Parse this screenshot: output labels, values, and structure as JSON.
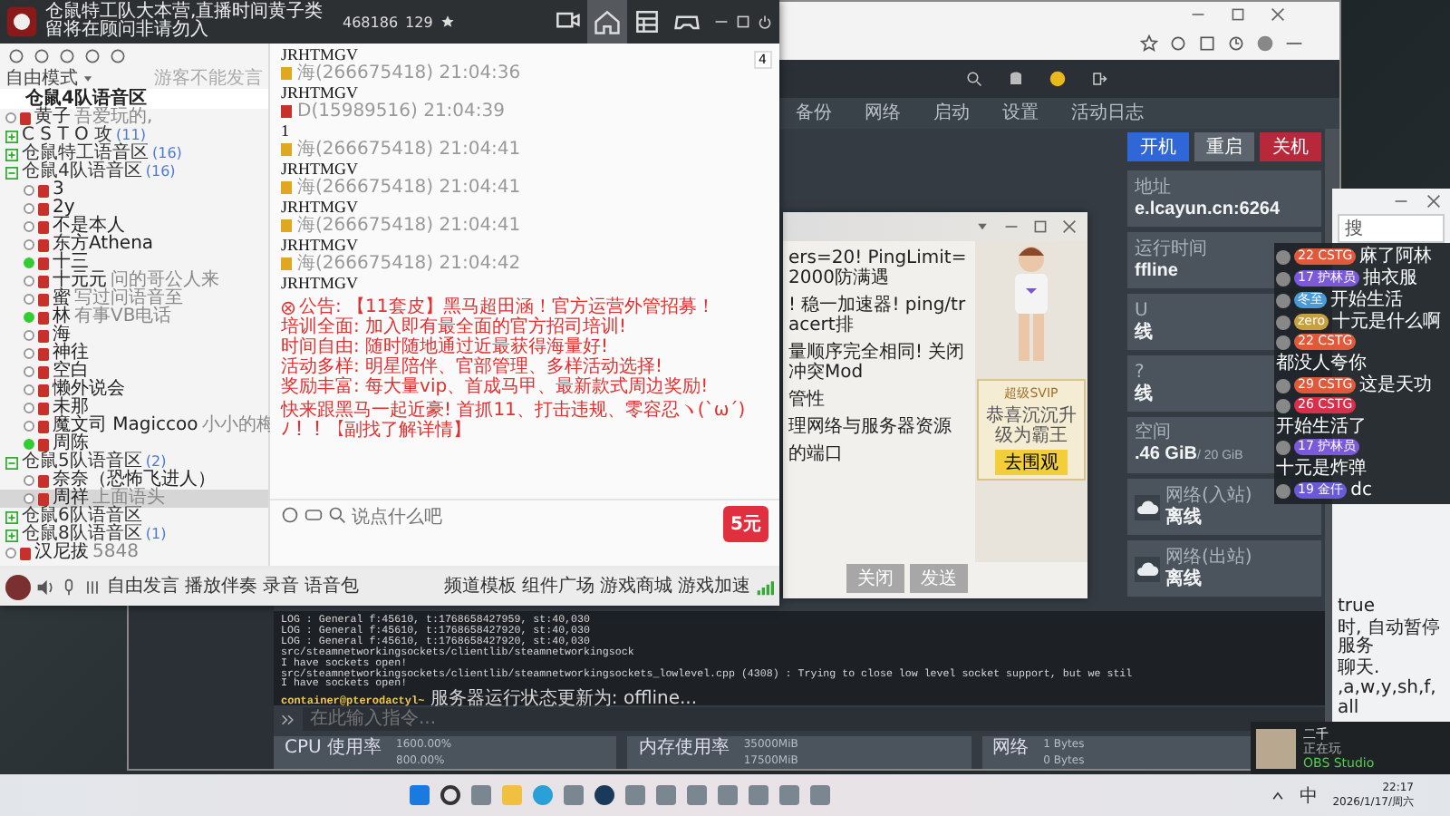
{
  "yy_window": {
    "title": "仓鼠特工队大本营,直播时间黄子类留将在顾问非请勿入",
    "channel_id": "468186",
    "online": "129",
    "tabs": [
      {
        "kind": "video",
        "selected": false
      },
      {
        "kind": "home",
        "selected": true
      },
      {
        "kind": "grid",
        "selected": false
      },
      {
        "kind": "game",
        "selected": false
      }
    ],
    "mode": "自由模式",
    "mode_hint": "游客不能发言",
    "current_channel": "仓鼠4队语音区",
    "tree": [
      {
        "kind": "user",
        "name": "黄子",
        "note": "吾爱玩的,",
        "selected": false,
        "speaking": false
      },
      {
        "kind": "channel",
        "name": "C S T O 攻",
        "count": "(11)",
        "expanded": false
      },
      {
        "kind": "channel",
        "name": "仓鼠特工语音区",
        "count": "(16)",
        "expanded": false
      },
      {
        "kind": "channel",
        "name": "仓鼠4队语音区",
        "count": "(16)",
        "expanded": true,
        "children": [
          {
            "kind": "user",
            "name": "3",
            "selected": false,
            "speaking": false
          },
          {
            "kind": "user",
            "name": "2y",
            "selected": false,
            "speaking": false
          },
          {
            "kind": "user",
            "name": "不是本人",
            "selected": false,
            "speaking": false
          },
          {
            "kind": "user",
            "name": "东方Athena",
            "selected": false,
            "speaking": false
          },
          {
            "kind": "user",
            "name": "十三",
            "selected": false,
            "speaking": true
          },
          {
            "kind": "user",
            "name": "十元元",
            "note": "问的哥公人来",
            "selected": false,
            "speaking": false
          },
          {
            "kind": "user",
            "name": "蜜",
            "note": "写过问语音至",
            "selected": false,
            "speaking": false
          },
          {
            "kind": "user",
            "name": "林",
            "note": "有事VB电话",
            "selected": false,
            "speaking": true
          },
          {
            "kind": "user",
            "name": "海",
            "selected": false,
            "speaking": false
          },
          {
            "kind": "user",
            "name": "神往",
            "selected": false,
            "speaking": false
          },
          {
            "kind": "user",
            "name": "空白",
            "selected": false,
            "speaking": false
          },
          {
            "kind": "user",
            "name": "懒外说会",
            "selected": false,
            "speaking": false
          },
          {
            "kind": "user",
            "name": "未那",
            "selected": false,
            "speaking": false
          },
          {
            "kind": "user",
            "name": "魔文司 Magiccoo",
            "note": "小小的梅",
            "selected": false,
            "speaking": false
          },
          {
            "kind": "user",
            "name": "周陈",
            "selected": false,
            "speaking": true
          }
        ]
      },
      {
        "kind": "channel",
        "name": "仓鼠5队语音区",
        "count": "(2)",
        "expanded": true,
        "children": [
          {
            "kind": "user",
            "name": "奈奈（恐怖飞进人）",
            "selected": false,
            "speaking": false
          },
          {
            "kind": "user",
            "name": "周祥",
            "note": "上面语头",
            "selected": true,
            "speaking": false
          }
        ]
      },
      {
        "kind": "channel",
        "name": "仓鼠6队语音区",
        "expanded": false
      },
      {
        "kind": "channel",
        "name": "仓鼠8队语音区",
        "count": "(1)",
        "expanded": false
      },
      {
        "kind": "user",
        "name": "汉尼拔",
        "note": "5848",
        "selected": false,
        "speaking": false
      }
    ],
    "page_count": "4",
    "messages": [
      {
        "text": "JRHTMGV"
      },
      {
        "sender": "海(266675418)",
        "time": "21:04:36",
        "color": "#e0a820",
        "text": "JRHTMGV"
      },
      {
        "sender": "D(15989516)",
        "time": "21:04:39",
        "color": "#c8302c",
        "text": "1"
      },
      {
        "sender": "海(266675418)",
        "time": "21:04:41",
        "color": "#e0a820",
        "text": "JRHTMGV"
      },
      {
        "sender": "海(266675418)",
        "time": "21:04:41",
        "color": "#e0a820",
        "text": "JRHTMGV"
      },
      {
        "sender": "海(266675418)",
        "time": "21:04:41",
        "color": "#e0a820",
        "text": "JRHTMGV"
      },
      {
        "sender": "海(266675418)",
        "time": "21:04:42",
        "color": "#e0a820",
        "text": "JRHTMGV"
      }
    ],
    "notice": {
      "title": "公告: 【11套皮】黑马超田涵！官方运营外管招募！",
      "lines": [
        "培训全面: 加入即有最全面的官方招司培训!",
        "时间自由: 随时随地通过近最获得海量好!",
        "活动多样: 明星陪伴、官部管理、多样活动选择!",
        "奖励丰富: 每大量vip、首成马甲、最新款式周边奖励!"
      ],
      "footer": "快来跟黑马一起近豪! 首抓11、打击违规、零容忍ヽ(`ω´)ﾉ！！【副找了解详情】"
    },
    "promo_badge": "5元",
    "input_placeholder": "说点什么吧",
    "toolbar": [
      "自由发言",
      "播放伴奏",
      "录音",
      "语音包"
    ],
    "toolbar_right": [
      "频道模板",
      "组件广场",
      "游戏商城",
      "游戏加速"
    ]
  },
  "browser": {
    "nav": [
      "备份",
      "网络",
      "启动",
      "设置",
      "活动日志"
    ],
    "power_buttons": [
      {
        "label": "开机",
        "kind": "start"
      },
      {
        "label": "重启",
        "kind": "restart"
      },
      {
        "label": "关机",
        "kind": "stop"
      }
    ],
    "stats": [
      {
        "label": "地址",
        "value": "e.lcayun.cn:6264"
      },
      {
        "label": "运行时间",
        "value": "ffline"
      },
      {
        "label": "U",
        "value": "线"
      },
      {
        "label": "?",
        "value": "线"
      },
      {
        "label": "空间",
        "value": ".46 GiB",
        "unit": "/ 20 GiB"
      },
      {
        "label": "网络(入站)",
        "value": "离线",
        "kind": "network"
      },
      {
        "label": "网络(出站)",
        "value": "离线",
        "kind": "network"
      }
    ],
    "console": {
      "lines": [
        "LOG   : General       f:45610, t:1768658427959, st:40,030",
        "LOG   : General       f:45610, t:1768658427920, st:40,030",
        "LOG   : General       f:45610, t:1768658427920, st:40,030",
        "src/steamnetworkingsockets/clientlib/steamnetworkingsock",
        "I have sockets open!",
        "src/steamnetworkingsockets/clientlib/steamnetworkingsockets_lowlevel.cpp (4308) : Trying to close low level socket support, but we stil",
        "I have sockets open!"
      ],
      "prompt": "container@pterodactyl~",
      "status": "服务器运行状态更新为: offline...",
      "placeholder": "在此输入指令..."
    },
    "charts": [
      {
        "title": "CPU 使用率",
        "ticks": [
          "1600.00%",
          "800.00%"
        ]
      },
      {
        "title": "内存使用率",
        "ticks": [
          "35000MiB",
          "17500MiB"
        ]
      },
      {
        "title": "网络",
        "ticks": [
          "1 Bytes",
          "0 Bytes"
        ]
      }
    ]
  },
  "chat_popup": {
    "lines": [
      "ers=20! PingLimit=2000防满遇",
      "! 稳一加速器! ping/tracert排",
      "量顺序完全相同! 关闭冲突Mod",
      "管性",
      "理网络与服务器资源",
      "的端口"
    ],
    "vip_title": "超级SVIP",
    "vip_text": "恭喜沉沉升级为霸王",
    "vip_button": "去围观",
    "buttons": [
      "关闭",
      "发送"
    ]
  },
  "danmaku": [
    {
      "badge": "22 CSTG",
      "color": "#e0593a",
      "text": "麻了阿林"
    },
    {
      "badge": "17 护林员",
      "color": "#7a5ad8",
      "text": "抽衣服"
    },
    {
      "badge": "冬至",
      "color": "#4a9ad8",
      "text": "开始生活"
    },
    {
      "badge": "zero",
      "color": "#c8a040",
      "text": "十元是什么啊"
    },
    {
      "badge": "22 CSTG",
      "color": "#e0593a",
      "text": "都没人夸你"
    },
    {
      "badge": "29 CSTG",
      "color": "#e0593a",
      "text": "这是天功"
    },
    {
      "badge": "26 CSTG",
      "color": "#d8304a",
      "text": "开始生活了"
    },
    {
      "badge": "17 护林员",
      "color": "#7a5ad8",
      "text": "十元是炸弹"
    },
    {
      "badge": "19 金仟",
      "color": "#6a5ad8",
      "text": "dc"
    }
  ],
  "side_window": {
    "search": "搜",
    "lines": [
      "true",
      "时, 自动暂停服务",
      "聊天.",
      ",a,w,y,sh,f,all"
    ]
  },
  "notification": {
    "name": "二千",
    "status": "正在玩",
    "app": "OBS Studio"
  },
  "taskbar": {
    "tray_lang": "中",
    "time": "22:17",
    "date": "2026/1/17/周六"
  }
}
